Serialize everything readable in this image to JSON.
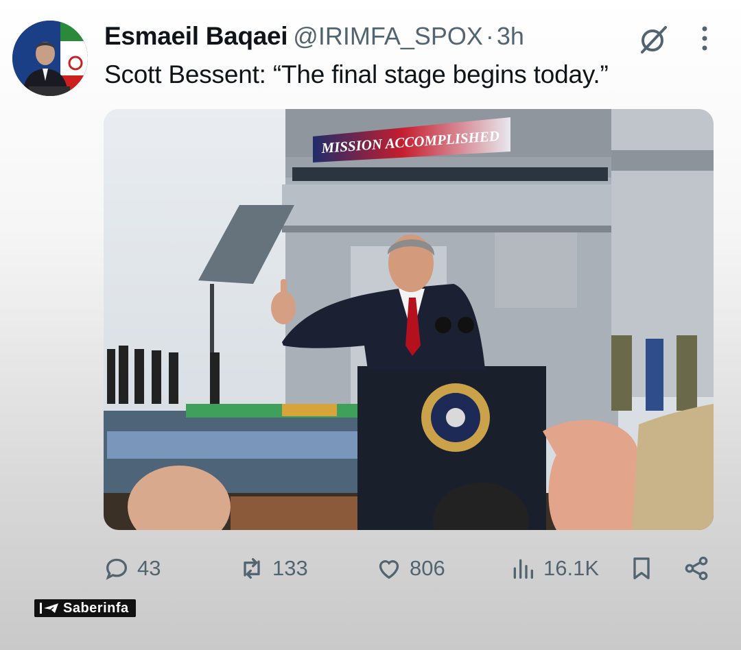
{
  "tweet": {
    "author_name": "Esmaeil Baqaei",
    "handle": "@IRIMFA_SPOX",
    "separator": "·",
    "time": "3h",
    "text": "Scott Bessent: “The final stage begins today.”"
  },
  "media": {
    "banner_text": "MISSION ACCOMPLISHED",
    "seal_text": "SEAL OF THE PRESIDENT OF THE UNITED STATES"
  },
  "actions": {
    "replies": "43",
    "reposts": "133",
    "likes": "806",
    "views": "16.1K"
  },
  "icons": [
    "grok-icon",
    "more-icon",
    "reply-icon",
    "repost-icon",
    "like-icon",
    "views-icon",
    "bookmark-icon",
    "share-icon",
    "telegram-icon"
  ],
  "watermark": {
    "text": "Saberinfa"
  },
  "colors": {
    "muted": "#536471",
    "text": "#0f1419",
    "banner_red": "#b01226"
  }
}
